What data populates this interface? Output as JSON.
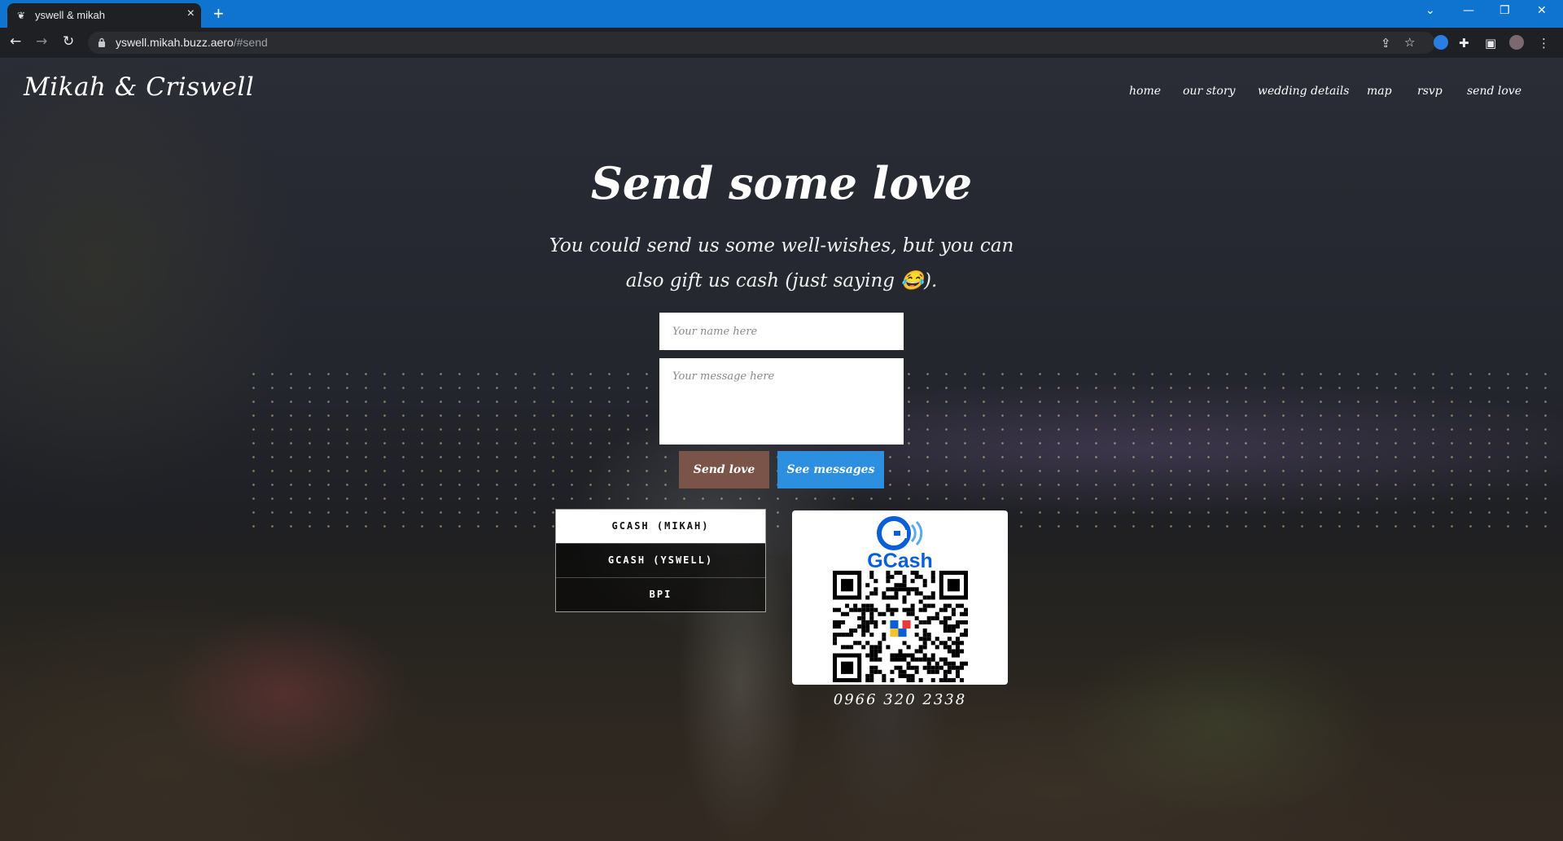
{
  "browser": {
    "tab_title": "yswell & mikah",
    "tab_close": "×",
    "new_tab": "+",
    "url_host": "yswell.mikah.buzz.aero",
    "url_path": "/#send",
    "accent": "#0f74d0"
  },
  "site": {
    "brand": "Mikah & Criswell",
    "nav": [
      "home",
      "our story",
      "wedding details",
      "map",
      "rsvp",
      "send love"
    ]
  },
  "hero": {
    "title": "Send some love",
    "subtitle": "You could send us some well-wishes, but you can also gift us cash (just saying 😂)."
  },
  "form": {
    "name_placeholder": "Your name here",
    "message_placeholder": "Your message here",
    "send_label": "Send love",
    "see_label": "See messages",
    "send_color": "#7a5448",
    "see_color": "#2d8fe0"
  },
  "payment": {
    "options": [
      "GCASH (MIKAH)",
      "GCASH (YSWELL)",
      "BPI"
    ],
    "selected": "GCASH (MIKAH)",
    "qr_brand": "GCash",
    "brand_color": "#0b5fd6",
    "number": "0966 320 2338"
  }
}
